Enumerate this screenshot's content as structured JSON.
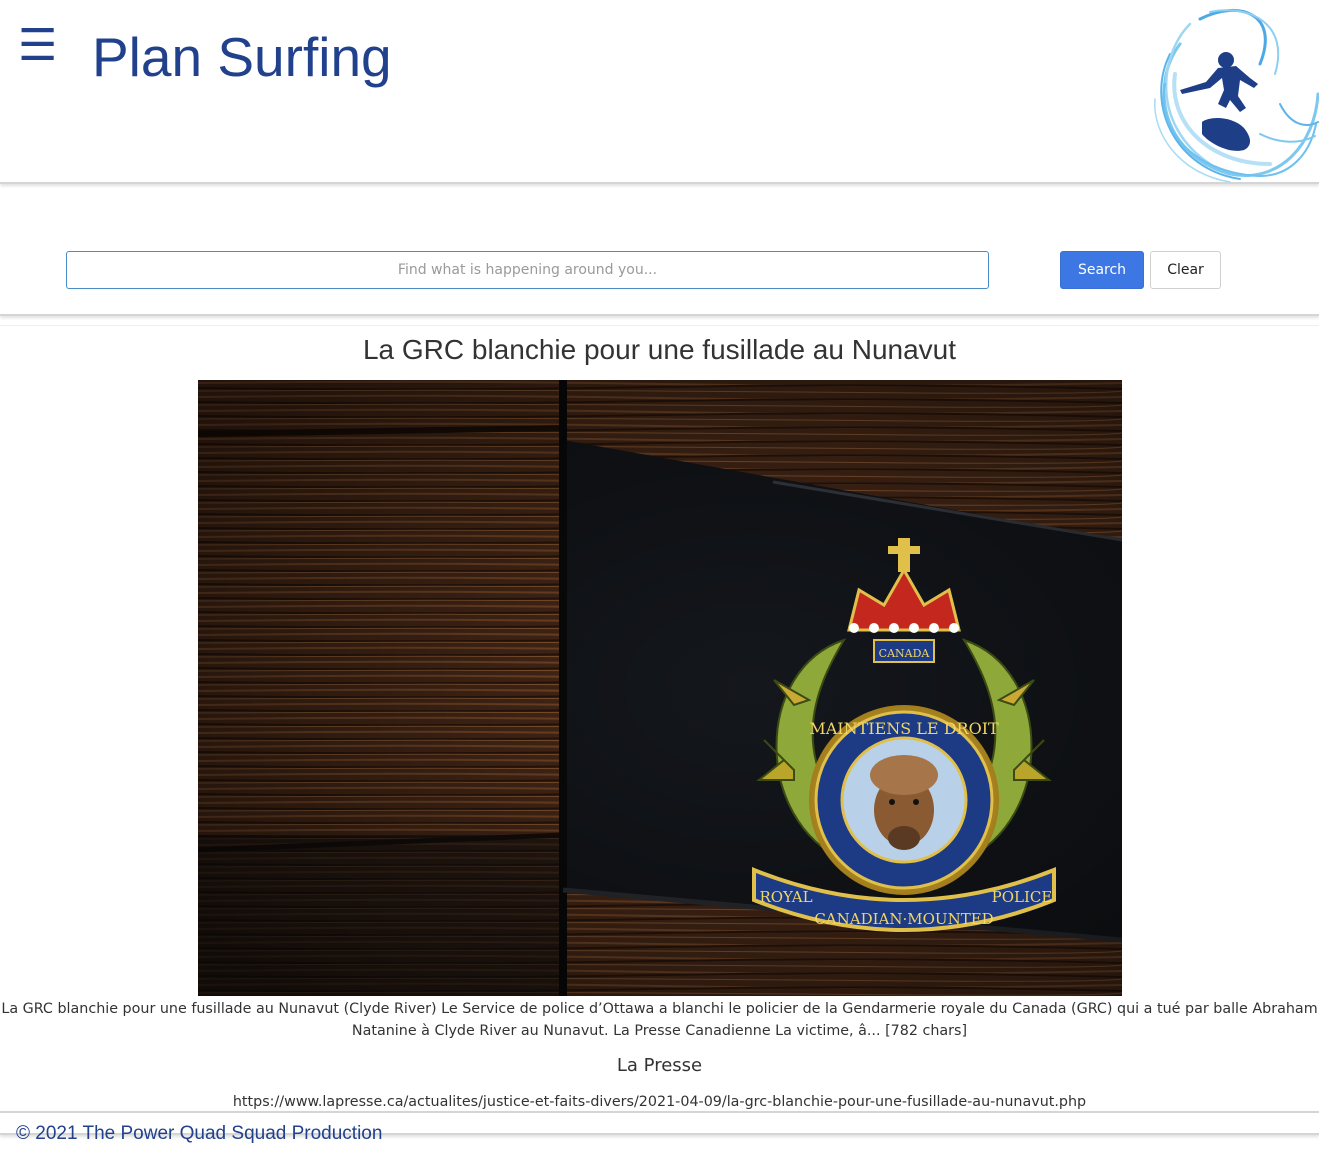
{
  "header": {
    "menu_icon": "hamburger-menu-icon",
    "menu_glyph": "☰",
    "title": "Plan Surfing",
    "logo_icon": "surfer-wave-logo",
    "brand_color": "#21418d"
  },
  "search": {
    "placeholder": "Find what is happening around you...",
    "value": "",
    "search_label": "Search",
    "clear_label": "Clear",
    "accent_color": "#3d77e3"
  },
  "article": {
    "title": "La GRC blanchie pour une fusillade au Nunavut",
    "image_description_icon": "rcmp-crest-photo",
    "summary": "La GRC blanchie pour une fusillade au Nunavut (Clyde River) Le Service de police d’Ottawa a blanchi le policier de la Gendarmerie royale du Canada (GRC) qui a tué par balle Abraham Natanine à Clyde River au Nunavut. La Presse Canadienne La victime, â... [782 chars]",
    "source": "La Presse",
    "url": "https://www.lapresse.ca/actualites/justice-et-faits-divers/2021-04-09/la-grc-blanchie-pour-une-fusillade-au-nunavut.php",
    "crest_text": {
      "top": "CANADA",
      "motto": "MAINTIENS LE DROIT",
      "banner_left": "ROYAL",
      "banner_mid": "CANADIAN·MOUNTED",
      "banner_right": "POLICE"
    }
  },
  "footer": {
    "text": "© 2021 The Power Quad Squad Production"
  }
}
